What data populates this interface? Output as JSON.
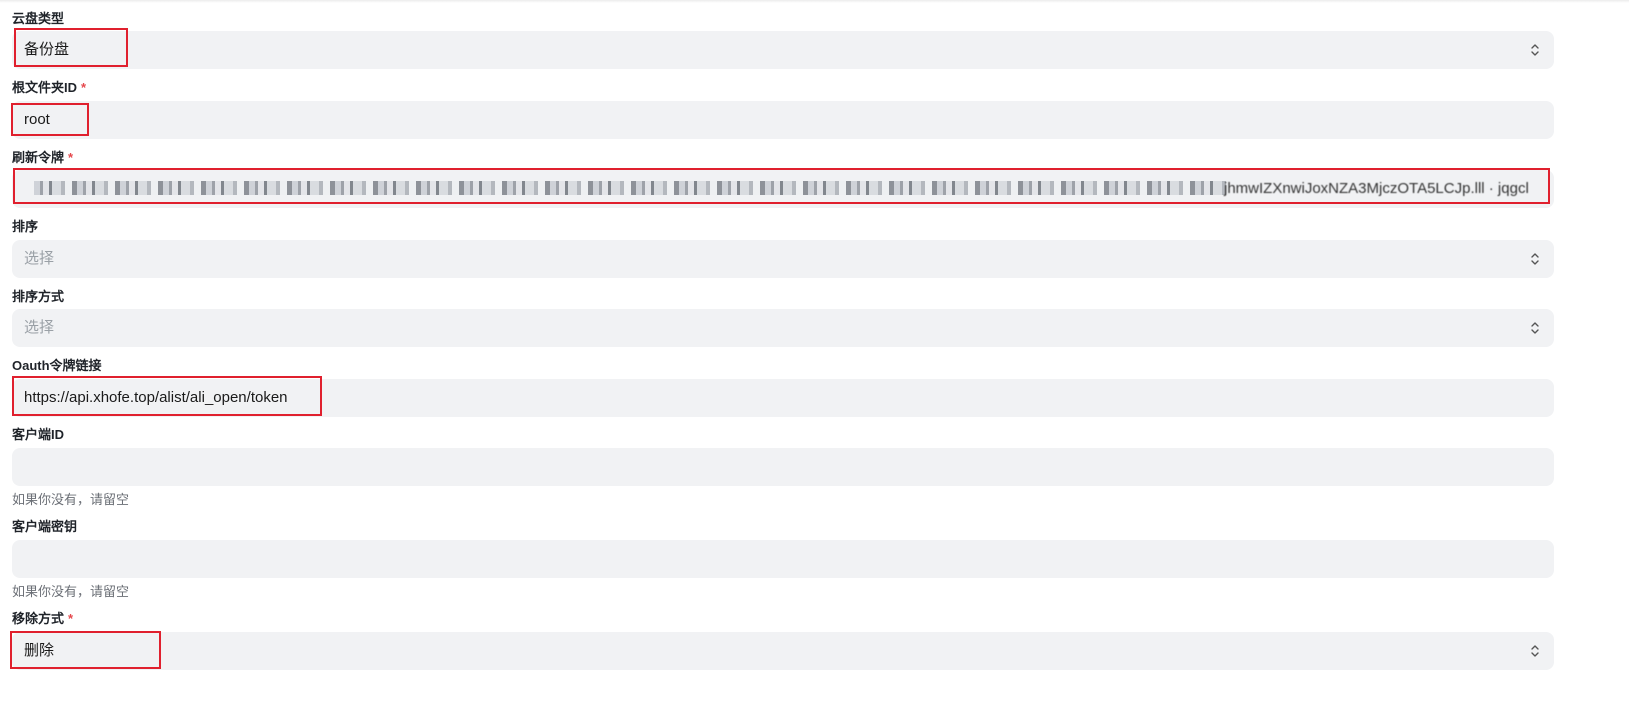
{
  "form": {
    "cloud_type": {
      "label": "云盘类型",
      "value": "备份盘"
    },
    "root_folder_id": {
      "label": "根文件夹ID",
      "required_mark": "*",
      "value": "root"
    },
    "refresh_token": {
      "label": "刷新令牌",
      "required_mark": "*",
      "visible_tail": "jhmwIZXnwiJoxNZA3MjczOTA5LCJp.lll · jqgcl"
    },
    "order_by": {
      "label": "排序",
      "placeholder": "选择"
    },
    "order_direction": {
      "label": "排序方式",
      "placeholder": "选择"
    },
    "oauth_token_url": {
      "label": "Oauth令牌链接",
      "value": "https://api.xhofe.top/alist/ali_open/token"
    },
    "client_id": {
      "label": "客户端ID",
      "value": "",
      "help": "如果你没有，请留空"
    },
    "client_secret": {
      "label": "客户端密钥",
      "value": "",
      "help": "如果你没有，请留空"
    },
    "remove_way": {
      "label": "移除方式",
      "required_mark": "*",
      "value": "删除"
    }
  },
  "colors": {
    "field_bg": "#f1f2f4",
    "required": "#e5484d",
    "highlight": "#e0202e",
    "placeholder": "#9aa0a6"
  },
  "icons": {
    "select": "chevron-up-down-icon"
  }
}
